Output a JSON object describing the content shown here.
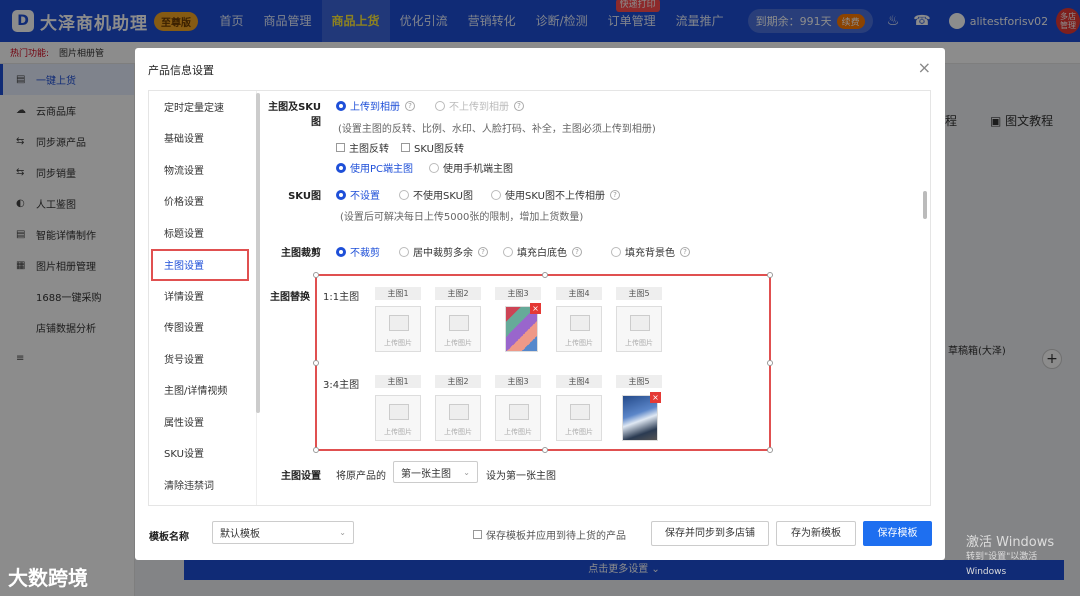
{
  "header": {
    "logo_mark": "D",
    "app_name": "大泽商机助理",
    "vip_badge": "至尊版",
    "nav": [
      {
        "label": "首页"
      },
      {
        "label": "商品管理"
      },
      {
        "label": "商品上货",
        "active": true
      },
      {
        "label": "优化引流"
      },
      {
        "label": "营销转化"
      },
      {
        "label": "诊断/检测"
      },
      {
        "label": "订单管理",
        "badge": "快递打印"
      },
      {
        "label": "流量推广"
      }
    ],
    "expire_label": "到期余：991天",
    "renew_label": "续费",
    "username": "alitestforisv02",
    "multi_store": "多店管理"
  },
  "hotbar": {
    "label": "热门功能:",
    "item": "图片相册管"
  },
  "sidebar": {
    "items": [
      {
        "label": "一键上货",
        "icon": "upload-icon",
        "glyph": "▤",
        "active": true
      },
      {
        "label": "云商品库",
        "icon": "cloud-icon",
        "glyph": "☁"
      },
      {
        "label": "同步源产品",
        "icon": "sync-icon",
        "glyph": "⇆"
      },
      {
        "label": "同步销量",
        "icon": "sync-sales-icon",
        "glyph": "⇆"
      },
      {
        "label": "人工鉴图",
        "icon": "eye-icon",
        "glyph": "◐"
      },
      {
        "label": "智能详情制作",
        "icon": "list-icon",
        "glyph": "▤"
      },
      {
        "label": "图片相册管理",
        "icon": "image-icon",
        "glyph": "▦"
      },
      {
        "label": "1688一键采购"
      },
      {
        "label": "店铺数据分析"
      },
      {
        "label": "",
        "icon": "menu-icon",
        "glyph": "≡"
      }
    ]
  },
  "background": {
    "text_a": "程",
    "text_b": "图文教程",
    "text_c": "草稿箱(大泽)",
    "more_settings": "点击更多设置",
    "brand_watermark": "大数跨境",
    "windows_line1": "激活 Windows",
    "windows_line2": "转到\"设置\"以激活 Windows"
  },
  "modal": {
    "title": "产品信息设置",
    "nav": [
      {
        "label": "定时定量定速"
      },
      {
        "label": "基础设置"
      },
      {
        "label": "物流设置"
      },
      {
        "label": "价格设置"
      },
      {
        "label": "标题设置"
      },
      {
        "label": "主图设置",
        "active": true
      },
      {
        "label": "详情设置"
      },
      {
        "label": "传图设置"
      },
      {
        "label": "货号设置"
      },
      {
        "label": "主图/详情视频"
      },
      {
        "label": "属性设置"
      },
      {
        "label": "SKU设置"
      },
      {
        "label": "清除违禁词"
      }
    ],
    "sku_image": {
      "label": "主图及SKU图",
      "opt_upload": "上传到相册",
      "opt_no_upload": "不上传到相册",
      "note": "(设置主图的反转、比例、水印、人脸打码、补全，主图必须上传到相册)",
      "check_flip_main": "主图反转",
      "check_flip_sku": "SKU图反转",
      "opt_pc": "使用PC端主图",
      "opt_mobile": "使用手机端主图"
    },
    "sku": {
      "label": "SKU图",
      "opt_none": "不设置",
      "opt_no_sku": "不使用SKU图",
      "opt_sku_no_upload": "使用SKU图不上传相册",
      "note": "(设置后可解决每日上传5000张的限制，增加上货数量)"
    },
    "crop": {
      "label": "主图裁剪",
      "opt_none": "不裁剪",
      "opt_center": "居中裁剪多余",
      "opt_white": "填充白底色",
      "opt_bg": "填充背景色"
    },
    "replace": {
      "label": "主图替换",
      "row1_label": "1:1主图",
      "row2_label": "3:4主图",
      "cols": [
        "主图1",
        "主图2",
        "主图3",
        "主图4",
        "主图5"
      ],
      "upload_text": "上传图片",
      "delete_mark": "×"
    },
    "main_set": {
      "label": "主图设置",
      "prefix": "将原产品的",
      "select_value": "第一张主图",
      "suffix": "设为第一张主图"
    },
    "footer": {
      "template_label": "模板名称",
      "template_value": "默认模板",
      "apply_check": "保存模板并应用到待上货的产品",
      "btn_sync": "保存并同步到多店铺",
      "btn_new": "存为新模板",
      "btn_save": "保存模板"
    },
    "close_glyph": "×",
    "help_glyph": "?",
    "chevron_glyph": "⌄"
  },
  "colors": {
    "brand": "#1e4fd8",
    "highlight": "#e05050",
    "primary_button": "#1e6ff0"
  }
}
